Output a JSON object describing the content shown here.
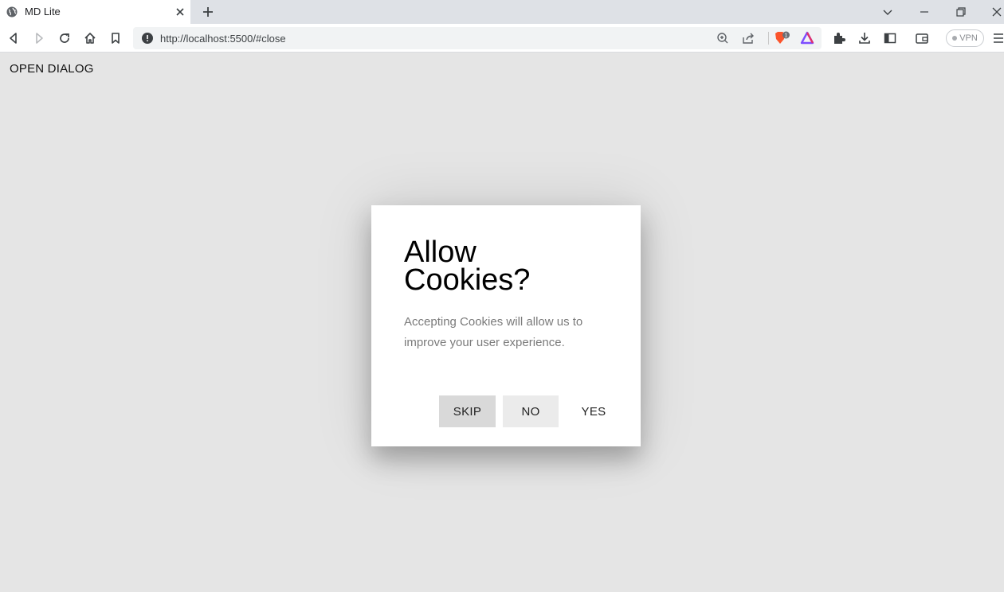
{
  "browser": {
    "tab": {
      "title": "MD Lite"
    },
    "url": "http://localhost:5500/#close",
    "vpn_label": "VPN",
    "brave_badge": "1"
  },
  "page": {
    "open_dialog_label": "OPEN DIALOG"
  },
  "dialog": {
    "title": "Allow Cookies?",
    "text": "Accepting Cookies will allow us to improve your user experience.",
    "buttons": {
      "skip": "SKIP",
      "no": "NO",
      "yes": "YES"
    }
  },
  "colors": {
    "page_background": "#e5e5e5",
    "dialog_background": "#ffffff",
    "skip_button": "#d9d9d9",
    "no_button": "#ebebeb"
  }
}
